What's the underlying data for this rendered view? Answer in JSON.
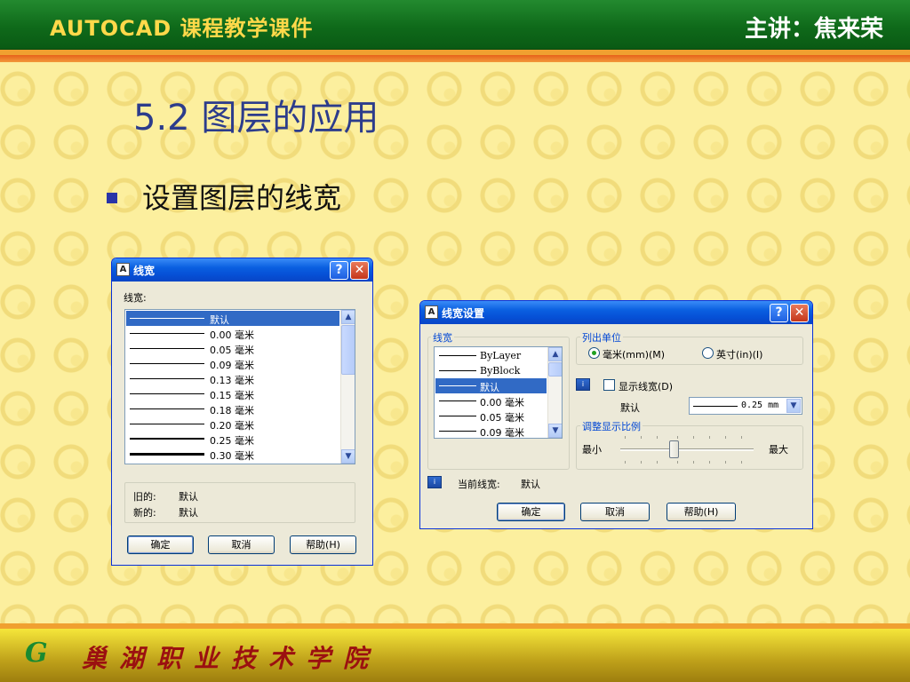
{
  "slide": {
    "header_title": "AUTOCAD 课程教学课件",
    "presenter": "主讲：焦来荣",
    "title": "5.2  图层的应用",
    "bullet": "设置图层的线宽",
    "footer_logo": "G",
    "footer_school": "巢湖职业技术学院",
    "colors": {
      "header_green": "#0f6a1a",
      "title_blue": "#2c3c8c",
      "footer_red": "#9b1010",
      "background": "#fcef9e"
    }
  },
  "dialog1": {
    "title": "线宽",
    "help_icon": "?",
    "close_icon": "✕",
    "list_label": "线宽:",
    "items": [
      {
        "label": "默认"
      },
      {
        "label": "0.00 毫米"
      },
      {
        "label": "0.05 毫米"
      },
      {
        "label": "0.09 毫米"
      },
      {
        "label": "0.13 毫米"
      },
      {
        "label": "0.15 毫米"
      },
      {
        "label": "0.18 毫米"
      },
      {
        "label": "0.20 毫米"
      },
      {
        "label": "0.25 毫米"
      },
      {
        "label": "0.30 毫米"
      }
    ],
    "selected_index": 0,
    "old_label": "旧的:",
    "old_value": "默认",
    "new_label": "新的:",
    "new_value": "默认",
    "ok": "确定",
    "cancel": "取消",
    "help": "帮助(H)"
  },
  "dialog2": {
    "title": "线宽设置",
    "help_icon": "?",
    "close_icon": "✕",
    "list_group": "线宽",
    "items": [
      {
        "label": "ByLayer"
      },
      {
        "label": "ByBlock"
      },
      {
        "label": "默认"
      },
      {
        "label": "0.00 毫米"
      },
      {
        "label": "0.05 毫米"
      },
      {
        "label": "0.09 毫米"
      }
    ],
    "selected_index": 2,
    "units_group": "列出单位",
    "unit_mm": "毫米(mm)(M)",
    "unit_in": "英寸(in)(I)",
    "unit_selected": "mm",
    "show_lineweight": "显示线宽(D)",
    "show_lineweight_checked": false,
    "default_label": "默认",
    "default_value": "0.25 mm",
    "scale_group": "调整显示比例",
    "scale_min": "最小",
    "scale_max": "最大",
    "scale_level": 0.4,
    "current_label": "当前线宽:",
    "current_value": "默认",
    "ok": "确定",
    "cancel": "取消",
    "help": "帮助(H)"
  }
}
